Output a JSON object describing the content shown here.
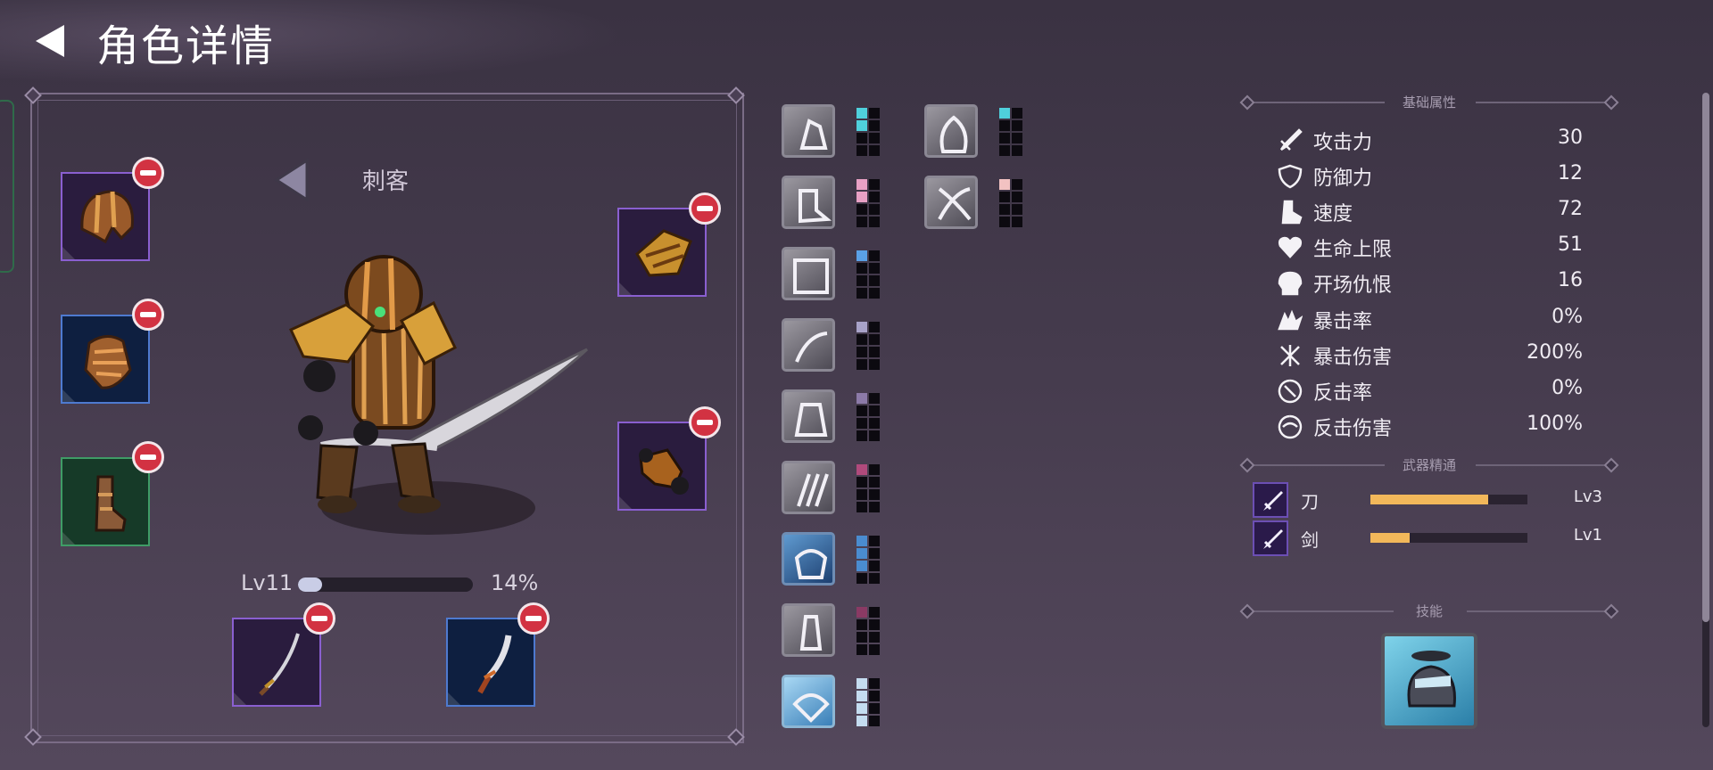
{
  "header": {
    "title": "角色详情",
    "back_icon": "back-arrow-icon"
  },
  "character": {
    "class_name": "刺客",
    "level": "Lv11",
    "xp_percent_text": "14%",
    "xp_fraction": 0.14,
    "equipment": [
      {
        "slot": "helmet",
        "rarity": "purple",
        "icon": "helmet-icon"
      },
      {
        "slot": "armor",
        "rarity": "blue",
        "icon": "chest-armor-icon"
      },
      {
        "slot": "boots",
        "rarity": "green",
        "icon": "boots-icon"
      },
      {
        "slot": "shoulder",
        "rarity": "purple",
        "icon": "shoulder-guard-icon"
      },
      {
        "slot": "gloves",
        "rarity": "purple",
        "icon": "gauntlet-icon"
      },
      {
        "slot": "main-weapon",
        "rarity": "purple",
        "icon": "katana-icon"
      },
      {
        "slot": "off-weapon",
        "rarity": "blue",
        "icon": "dagger-icon"
      }
    ]
  },
  "passive_skills": [
    {
      "icon": "grab-icon",
      "filled": 2,
      "color": "#4fd0dc"
    },
    {
      "icon": "spectre-icon",
      "filled": 1,
      "color": "#4fd0dc"
    },
    {
      "icon": "kick-icon",
      "filled": 2,
      "color": "#e8a0c4"
    },
    {
      "icon": "crossed-blades-icon",
      "filled": 1,
      "color": "#f2c2c2"
    },
    {
      "icon": "spiked-shield-icon",
      "filled": 1,
      "color": "#5aa0e6"
    },
    {
      "icon": "slash-icon",
      "filled": 1,
      "color": "#a8a2c8"
    },
    {
      "icon": "warrior-icon",
      "filled": 1,
      "color": "#8c7aa8"
    },
    {
      "icon": "claw-marks-icon",
      "filled": 1,
      "color": "#b04a7c"
    },
    {
      "icon": "brawler-icon",
      "filled": 3,
      "color": "#4a8cd0"
    },
    {
      "icon": "totem-icon",
      "filled": 1,
      "color": "#8a3a64"
    },
    {
      "icon": "winged-emblem-icon",
      "filled": 4,
      "color": "#c4dcf0"
    }
  ],
  "attributes": {
    "title": "基础属性",
    "items": [
      {
        "icon": "sword-icon",
        "name": "攻击力",
        "value": "30"
      },
      {
        "icon": "shield-icon",
        "name": "防御力",
        "value": "12"
      },
      {
        "icon": "boot-speed-icon",
        "name": "速度",
        "value": "72"
      },
      {
        "icon": "heart-icon",
        "name": "生命上限",
        "value": "51"
      },
      {
        "icon": "skull-icon",
        "name": "开场仇恨",
        "value": "16"
      },
      {
        "icon": "crit-icon",
        "name": "暴击率",
        "value": "0%"
      },
      {
        "icon": "crit-damage-icon",
        "name": "暴击伤害",
        "value": "200%"
      },
      {
        "icon": "counter-icon",
        "name": "反击率",
        "value": "0%"
      },
      {
        "icon": "counter-damage-icon",
        "name": "反击伤害",
        "value": "100%"
      }
    ]
  },
  "mastery": {
    "title": "武器精通",
    "items": [
      {
        "icon": "blade-mastery-icon",
        "name": "刀",
        "level": "Lv3",
        "progress": 0.75
      },
      {
        "icon": "sword-mastery-icon",
        "name": "剑",
        "level": "Lv1",
        "progress": 0.25
      }
    ]
  },
  "skills": {
    "title": "技能",
    "icon": "ninja-skill-icon"
  }
}
